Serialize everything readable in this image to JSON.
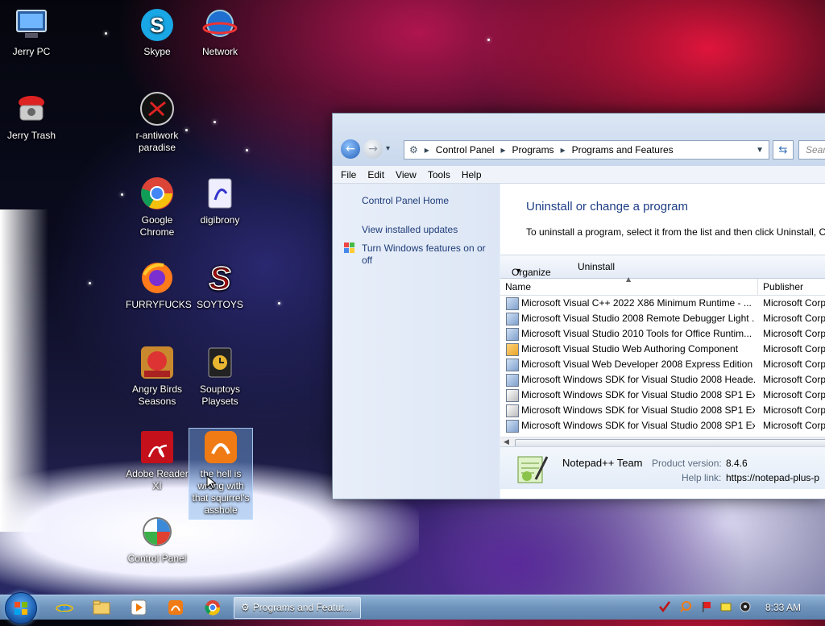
{
  "desktop": {
    "icons": [
      {
        "label": "Jerry PC"
      },
      {
        "label": "Skype"
      },
      {
        "label": "Network"
      },
      {
        "label": "Jerry Trash"
      },
      {
        "label": "r-antiwork paradise"
      },
      {
        "label": "Google Chrome"
      },
      {
        "label": "digibrony"
      },
      {
        "label": "FURRYFUCKS"
      },
      {
        "label": "SOYTOYS"
      },
      {
        "label": "Angry Birds Seasons"
      },
      {
        "label": "Souptoys Playsets"
      },
      {
        "label": "Adobe Reader XI"
      },
      {
        "label": "the hell is wrong with that squirrel's asshole"
      },
      {
        "label": "Control Panel"
      }
    ]
  },
  "window": {
    "breadcrumb": [
      "Control Panel",
      "Programs",
      "Programs and Features"
    ],
    "search_placeholder": "Search Pr",
    "menu": [
      "File",
      "Edit",
      "View",
      "Tools",
      "Help"
    ],
    "sidebar": {
      "home": "Control Panel Home",
      "updates": "View installed updates",
      "features": "Turn Windows features on or off"
    },
    "heading": "Uninstall or change a program",
    "description": "To uninstall a program, select it from the list and then click Uninstall, C",
    "toolbar": {
      "organize": "Organize",
      "uninstall": "Uninstall"
    },
    "columns": {
      "name": "Name",
      "publisher": "Publisher"
    },
    "rows": [
      {
        "name": "Microsoft Visual C++ 2022 X86 Minimum Runtime - ...",
        "publisher": "Microsoft Corp"
      },
      {
        "name": "Microsoft Visual Studio 2008 Remote Debugger Light ...",
        "publisher": "Microsoft Corp"
      },
      {
        "name": "Microsoft Visual Studio 2010 Tools for Office Runtim...",
        "publisher": "Microsoft Corp"
      },
      {
        "name": "Microsoft Visual Studio Web Authoring Component",
        "publisher": "Microsoft Corp"
      },
      {
        "name": "Microsoft Visual Web Developer 2008 Express Edition ...",
        "publisher": "Microsoft Corp"
      },
      {
        "name": "Microsoft Windows SDK for Visual Studio 2008 Heade...",
        "publisher": "Microsoft Corp"
      },
      {
        "name": "Microsoft Windows SDK for Visual Studio 2008 SP1 Ex...",
        "publisher": "Microsoft Corp"
      },
      {
        "name": "Microsoft Windows SDK for Visual Studio 2008 SP1 Ex...",
        "publisher": "Microsoft Corp"
      },
      {
        "name": "Microsoft Windows SDK for Visual Studio 2008 SP1 Ex...",
        "publisher": "Microsoft Corp"
      }
    ],
    "details": {
      "name": "Notepad++ Team",
      "version_label": "Product version:",
      "version": "8.4.6",
      "help_label": "Help link:",
      "help_link": "https://notepad-plus-p"
    }
  },
  "taskbar": {
    "active_task": "Programs and Featur...",
    "clock": "8:33 AM"
  }
}
